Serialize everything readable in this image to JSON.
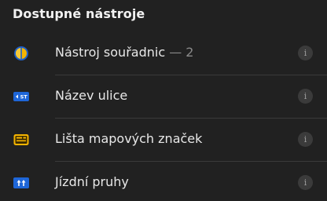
{
  "section": {
    "title": "Dostupné nástroje"
  },
  "tools": [
    {
      "label": "Nástroj souřadnic",
      "count": " — 2",
      "icon": "coordinates-icon",
      "info": "i"
    },
    {
      "label": "Název ulice",
      "badge": "ST",
      "icon": "street-name-icon",
      "info": "i"
    },
    {
      "label": "Lišta mapových značek",
      "icon": "map-marker-bar-icon",
      "info": "i"
    },
    {
      "label": "Jízdní pruhy",
      "icon": "lanes-icon",
      "info": "i"
    }
  ],
  "colors": {
    "background": "#212121",
    "divider": "#3a3a3a",
    "accent_yellow": "#f5b400",
    "accent_blue": "#1e66d8"
  }
}
